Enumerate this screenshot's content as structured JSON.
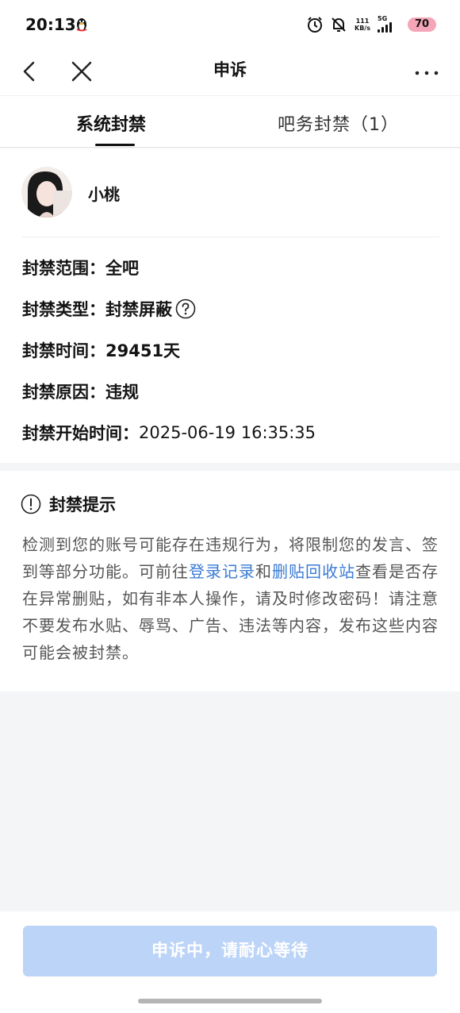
{
  "status_bar": {
    "time": "20:13",
    "net_speed_value": "111",
    "net_speed_unit": "KB/s",
    "network_type": "5G",
    "battery": "70"
  },
  "nav": {
    "title": "申诉"
  },
  "tabs": [
    {
      "label": "系统封禁",
      "active": true
    },
    {
      "label": "吧务封禁（1）",
      "active": false
    }
  ],
  "user": {
    "name": "小桃"
  },
  "ban_info": [
    {
      "label": "封禁范围：",
      "value": "全吧"
    },
    {
      "label": "封禁类型：",
      "value": "封禁屏蔽"
    },
    {
      "label": "封禁时间：",
      "value": "29451天"
    },
    {
      "label": "封禁原因：",
      "value": "违规"
    },
    {
      "label": "封禁开始时间：",
      "value": "2025-06-19 16:35:35"
    }
  ],
  "tips": {
    "title": "封禁提示",
    "text_part1": "检测到您的账号可能存在违规行为，将限制您的发言、签到等部分功能。可前往",
    "link1": "登录记录",
    "text_part2": "和",
    "link2": "删贴回收站",
    "text_part3": "查看是否存在异常删贴，如有非本人操作，请及时修改密码！请注意不要发布水贴、辱骂、广告、违法等内容，发布这些内容可能会被封禁。"
  },
  "button": {
    "label": "申诉中，请耐心等待"
  },
  "colors": {
    "link": "#3a7bd5",
    "button_disabled": "#bcd4f7",
    "battery": "#f4a6b8"
  }
}
